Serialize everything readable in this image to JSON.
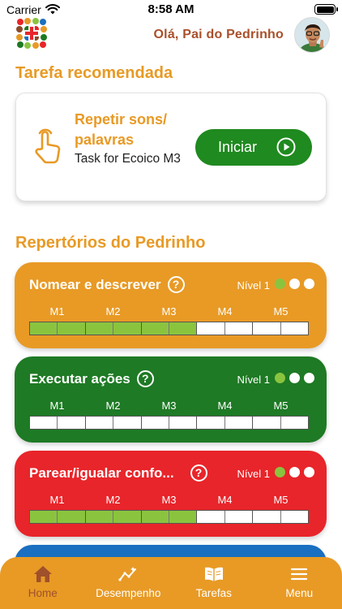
{
  "status_bar": {
    "carrier": "Carrier",
    "time": "8:58 AM"
  },
  "header": {
    "greeting": "Olá, Pai do Pedrinho"
  },
  "recommended": {
    "section_title": "Tarefa recomendada",
    "task_title": "Repetir sons/ palavras",
    "task_subtitle": "Task for Ecoico M3",
    "start_label": "Iniciar"
  },
  "repertoires": {
    "section_title": "Repertórios do Pedrinho",
    "milestones": [
      "M1",
      "M2",
      "M3",
      "M4",
      "M5"
    ],
    "items": [
      {
        "name": "Nomear e descrever",
        "level": "Nível 1",
        "color": "#e89a25",
        "levels_on": 1,
        "segments_done": 6
      },
      {
        "name": "Executar ações",
        "level": "Nível 1",
        "color": "#1e7a24",
        "levels_on": 1,
        "segments_done": 0
      },
      {
        "name": "Parear/igualar confo...",
        "level": "Nível 1",
        "color": "#e8252a",
        "levels_on": 1,
        "segments_done": 6
      },
      {
        "name": "",
        "level": "",
        "color": "#1a6fc0",
        "levels_on": 0,
        "segments_done": 0
      }
    ]
  },
  "tabbar": {
    "active": "home",
    "tabs": [
      {
        "id": "home",
        "label": "Home",
        "icon": "home-icon"
      },
      {
        "id": "performance",
        "label": "Desempenho",
        "icon": "chart-icon"
      },
      {
        "id": "tasks",
        "label": "Tarefas",
        "icon": "book-icon"
      },
      {
        "id": "menu",
        "label": "Menu",
        "icon": "menu-icon"
      }
    ]
  },
  "colors": {
    "accent": "#e89a25",
    "greeting": "#a9502a",
    "start_button": "#1f8a1f",
    "progress_done": "#8ac43f"
  }
}
